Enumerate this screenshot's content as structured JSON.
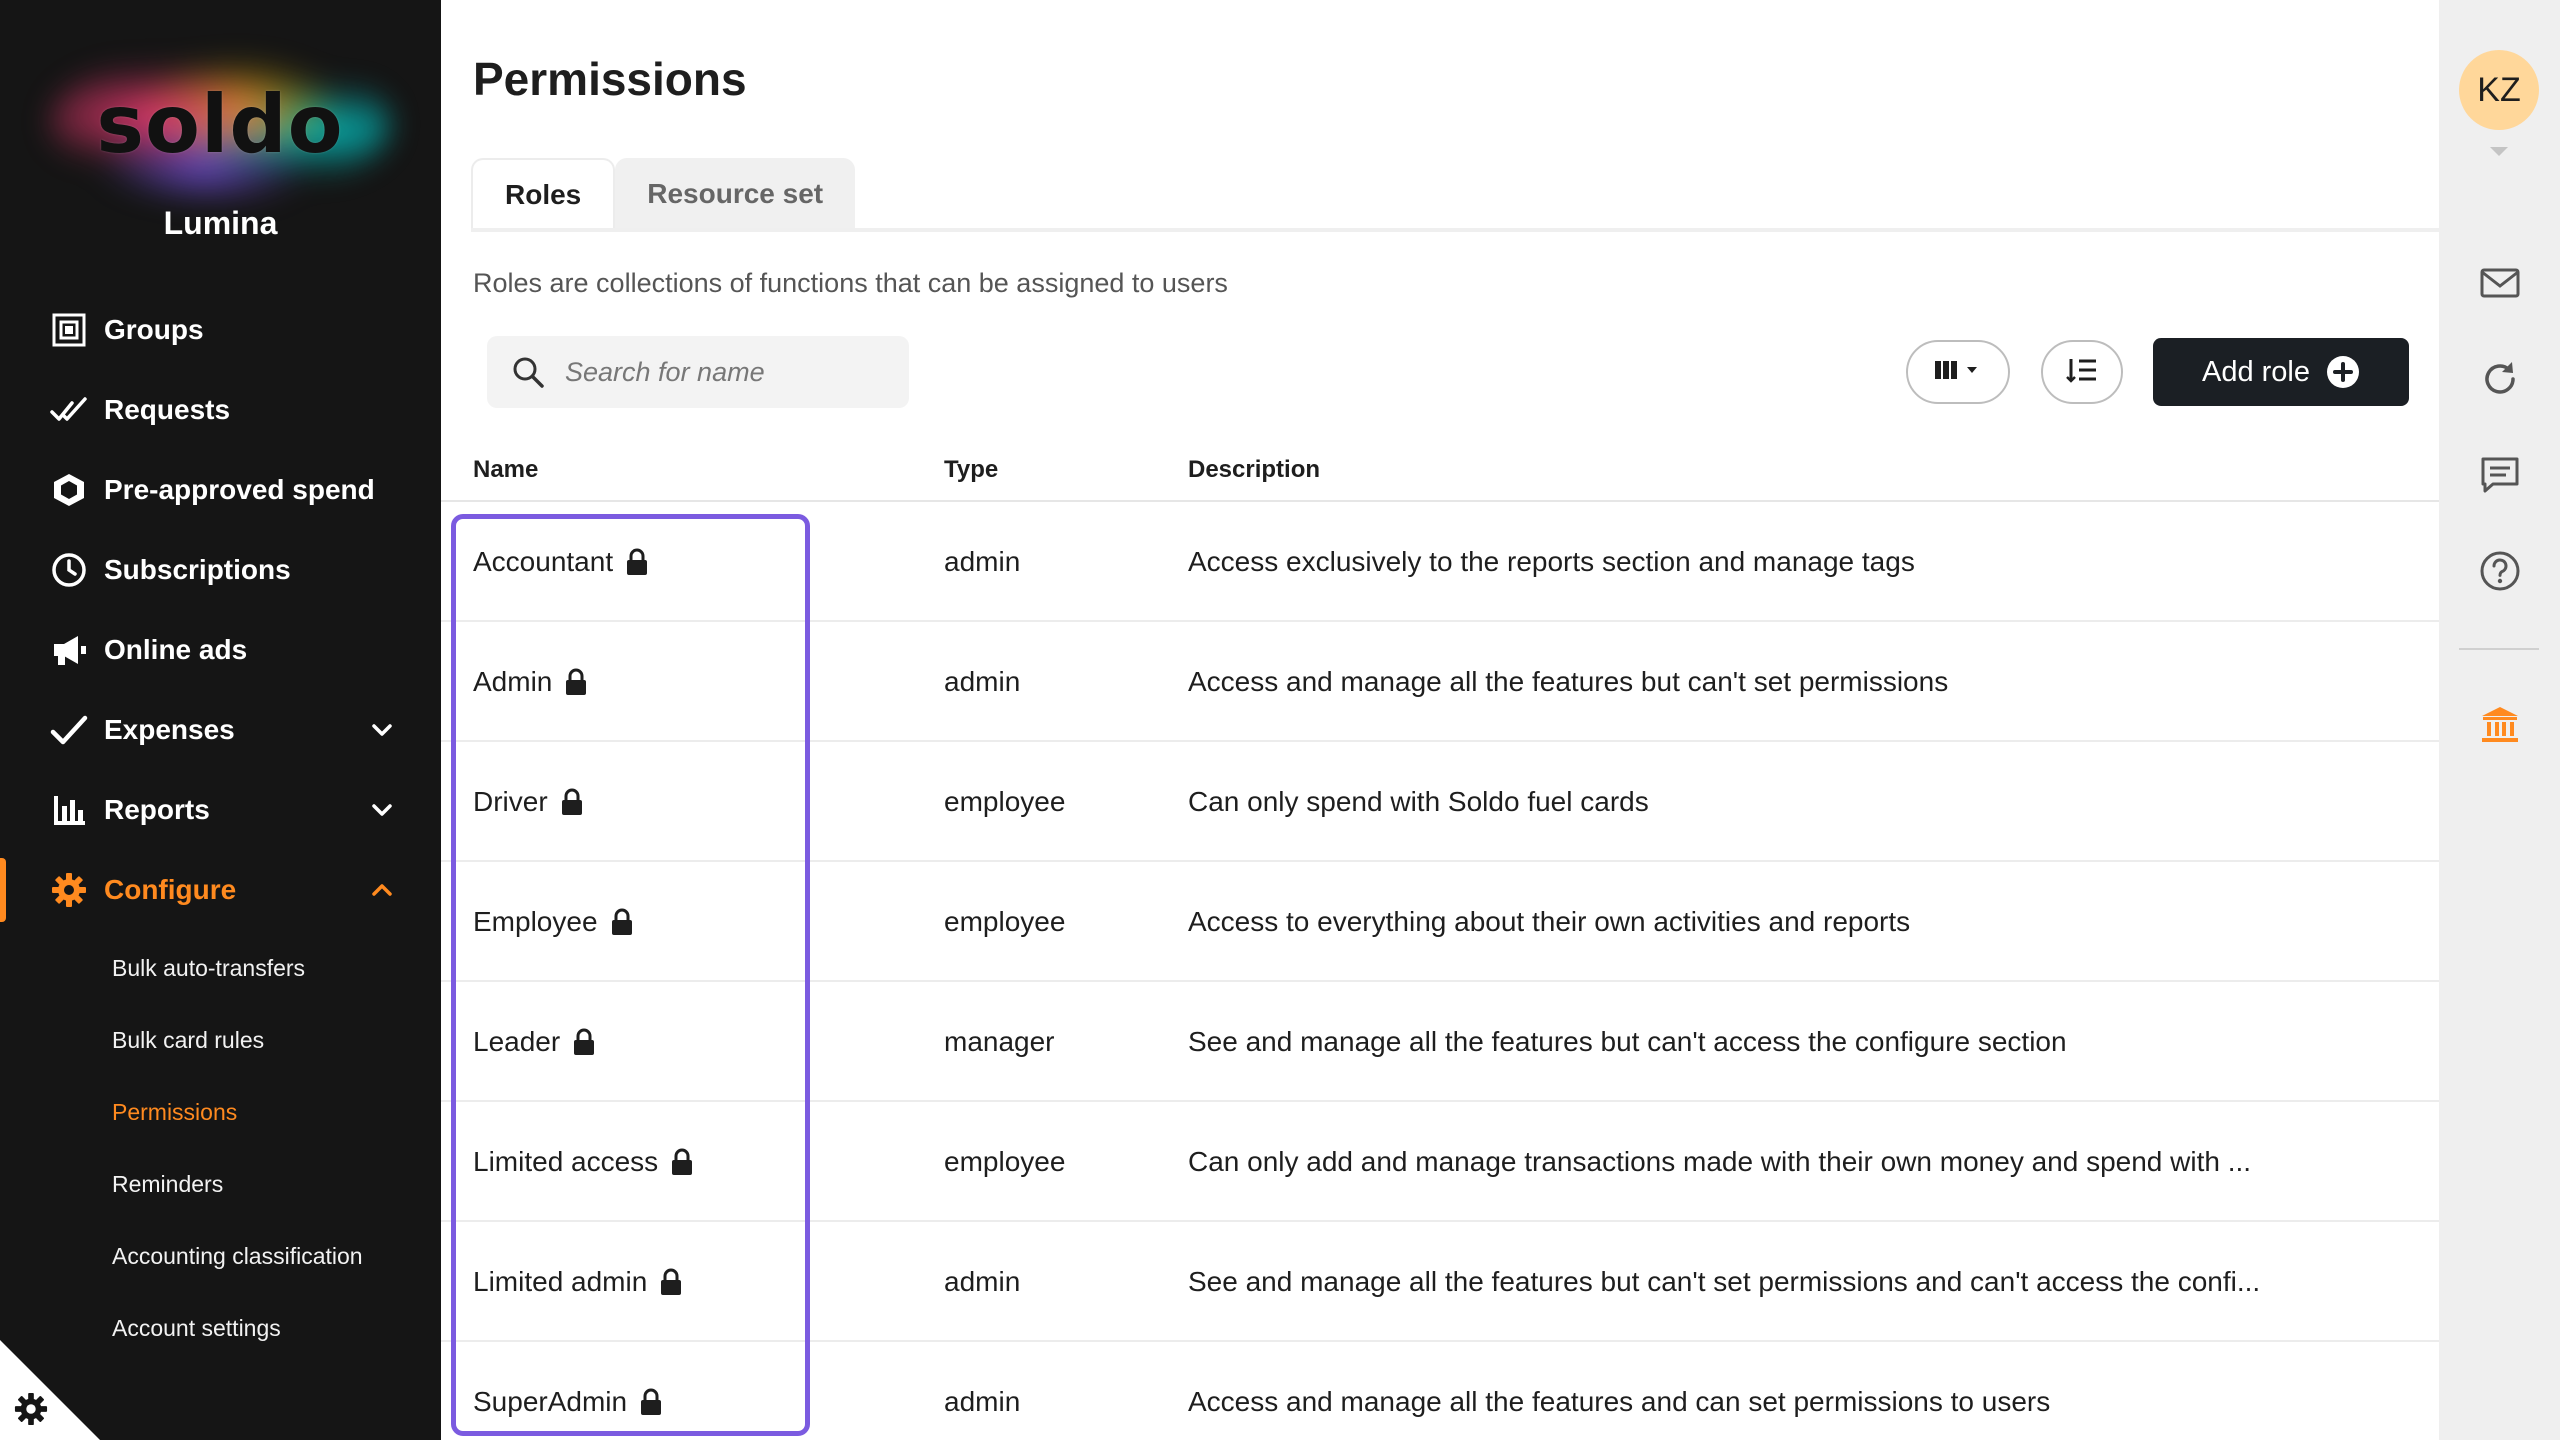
{
  "sidebar": {
    "logo_text": "soldo",
    "org_name": "Lumina",
    "items": [
      {
        "label": "Groups",
        "icon": "groups-icon"
      },
      {
        "label": "Requests",
        "icon": "requests-icon"
      },
      {
        "label": "Pre-approved spend",
        "icon": "pre-approved-icon"
      },
      {
        "label": "Subscriptions",
        "icon": "clock-icon"
      },
      {
        "label": "Online ads",
        "icon": "megaphone-icon"
      },
      {
        "label": "Expenses",
        "icon": "checkmark-icon"
      },
      {
        "label": "Reports",
        "icon": "bar-chart-icon"
      },
      {
        "label": "Configure",
        "icon": "gear-icon"
      }
    ],
    "sub_items": [
      {
        "label": "Bulk auto-transfers"
      },
      {
        "label": "Bulk card rules"
      },
      {
        "label": "Permissions"
      },
      {
        "label": "Reminders"
      },
      {
        "label": "Accounting classification"
      },
      {
        "label": "Account settings"
      }
    ]
  },
  "main": {
    "title": "Permissions",
    "tabs": [
      {
        "label": "Roles"
      },
      {
        "label": "Resource set"
      }
    ],
    "subtitle": "Roles are collections of functions that can be assigned to users",
    "search": {
      "placeholder": "Search for name",
      "value": ""
    },
    "add_role_label": "Add role",
    "table": {
      "headers": {
        "name": "Name",
        "type": "Type",
        "description": "Description"
      },
      "rows": [
        {
          "name": "Accountant",
          "type": "admin",
          "description": "Access exclusively to the reports section and manage tags"
        },
        {
          "name": "Admin",
          "type": "admin",
          "description": "Access and manage all the features but can't set permissions"
        },
        {
          "name": "Driver",
          "type": "employee",
          "description": "Can only spend with Soldo fuel cards"
        },
        {
          "name": "Employee",
          "type": "employee",
          "description": "Access to everything about their own activities and reports"
        },
        {
          "name": "Leader",
          "type": "manager",
          "description": "See and manage all the features but can't access the configure section"
        },
        {
          "name": "Limited access",
          "type": "employee",
          "description": "Can only add and manage transactions made with their own money and spend with ..."
        },
        {
          "name": "Limited admin",
          "type": "admin",
          "description": "See and manage all the features but can't set permissions and can't access the confi..."
        },
        {
          "name": "SuperAdmin",
          "type": "admin",
          "description": "Access and manage all the features and can set permissions to users"
        }
      ]
    }
  },
  "rail": {
    "avatar_initials": "KZ",
    "icons": [
      "mail-icon",
      "refresh-icon",
      "chat-icon",
      "help-icon",
      "bank-icon"
    ]
  },
  "colors": {
    "accent": "#ff8a1f",
    "sidebar_bg": "#151515",
    "highlight": "#7b5be0",
    "primary_button": "#1b1f24"
  }
}
